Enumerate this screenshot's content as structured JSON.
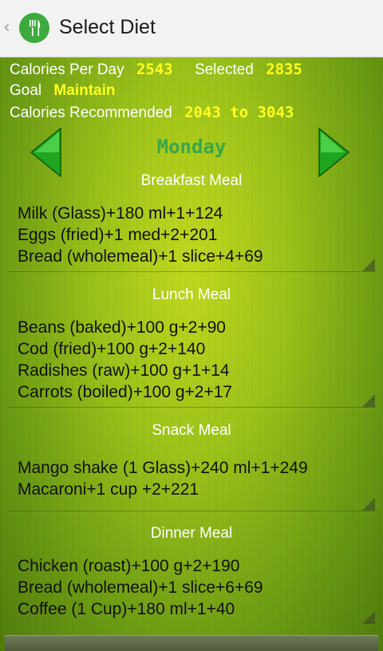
{
  "actionbar": {
    "title": "Select Diet",
    "up_icon": "chevron-left-icon",
    "app_icon": "fork-knife-icon"
  },
  "stats": {
    "calories_per_day_label": "Calories Per Day",
    "calories_per_day_value": "2543",
    "selected_label": "Selected",
    "selected_value": "2835",
    "goal_label": "Goal",
    "goal_value": "Maintain",
    "recommended_label": "Calories Recommended",
    "recommended_value": "2043 to 3043"
  },
  "day": "Monday",
  "meals": [
    {
      "title": "Breakfast Meal",
      "items": [
        "Milk (Glass)+180 ml+1+124",
        "Eggs (fried)+1 med+2+201",
        "Bread (wholemeal)+1 slice+4+69"
      ]
    },
    {
      "title": "Lunch Meal",
      "items": [
        "Beans (baked)+100 g+2+90",
        "Cod (fried)+100 g+2+140",
        "Radishes (raw)+100 g+1+14",
        "Carrots (boiled)+100 g+2+17"
      ]
    },
    {
      "title": "Snack Meal",
      "items": [
        "Mango shake (1 Glass)+240 ml+1+249",
        "Macaroni+1 cup +2+221"
      ]
    },
    {
      "title": "Dinner Meal",
      "items": [
        "Chicken (roast)+100 g+2+190",
        "Bread (wholemeal)+1 slice+6+69",
        "Coffee (1 Cup)+180 ml+1+40"
      ]
    }
  ],
  "colors": {
    "value_yellow": "#ffff22",
    "day_green": "#3aa64a",
    "arrow_green": "#22c02a"
  }
}
